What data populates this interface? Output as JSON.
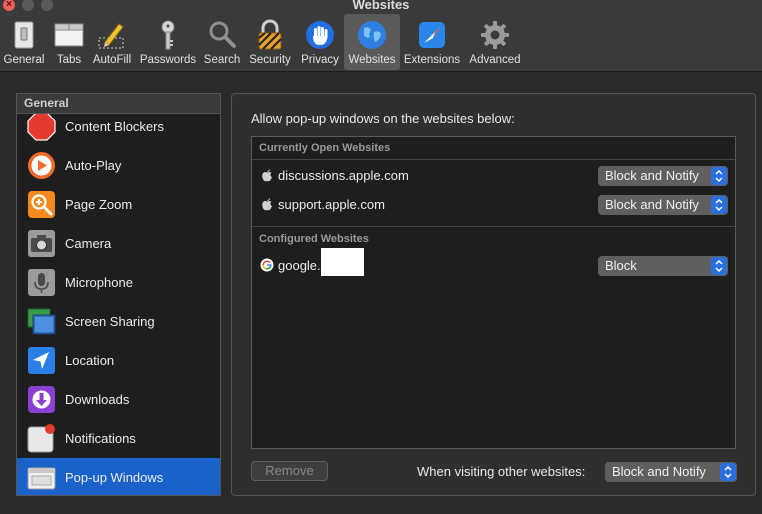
{
  "window": {
    "title": "Websites"
  },
  "toolbar": {
    "tabs": [
      {
        "label": "General"
      },
      {
        "label": "Tabs"
      },
      {
        "label": "AutoFill"
      },
      {
        "label": "Passwords"
      },
      {
        "label": "Search"
      },
      {
        "label": "Security"
      },
      {
        "label": "Privacy"
      },
      {
        "label": "Websites",
        "selected": true
      },
      {
        "label": "Extensions"
      },
      {
        "label": "Advanced"
      }
    ]
  },
  "sidebar": {
    "header": "General",
    "items": [
      {
        "label": "Content Blockers",
        "icon": "stop-sign-icon"
      },
      {
        "label": "Auto-Play",
        "icon": "play-icon"
      },
      {
        "label": "Page Zoom",
        "icon": "zoom-icon"
      },
      {
        "label": "Camera",
        "icon": "camera-icon"
      },
      {
        "label": "Microphone",
        "icon": "microphone-icon"
      },
      {
        "label": "Screen Sharing",
        "icon": "screen-sharing-icon"
      },
      {
        "label": "Location",
        "icon": "location-arrow-icon"
      },
      {
        "label": "Downloads",
        "icon": "download-icon"
      },
      {
        "label": "Notifications",
        "icon": "notification-icon"
      },
      {
        "label": "Pop-up Windows",
        "icon": "popup-window-icon",
        "selected": true
      }
    ]
  },
  "main": {
    "intro": "Allow pop-up windows on the websites below:",
    "open_header": "Currently Open Websites",
    "open_sites": [
      {
        "site": "discussions.apple.com",
        "setting": "Block and Notify",
        "icon": "apple-icon"
      },
      {
        "site": "support.apple.com",
        "setting": "Block and Notify",
        "icon": "apple-icon"
      }
    ],
    "configured_header": "Configured Websites",
    "configured_sites": [
      {
        "site": "google.",
        "setting": "Block",
        "icon": "google-icon"
      }
    ],
    "remove_label": "Remove",
    "other_label": "When visiting other websites:",
    "other_setting": "Block and Notify"
  },
  "colors": {
    "accent": "#1a62c9",
    "select_chevron": "#2a6fdb"
  }
}
